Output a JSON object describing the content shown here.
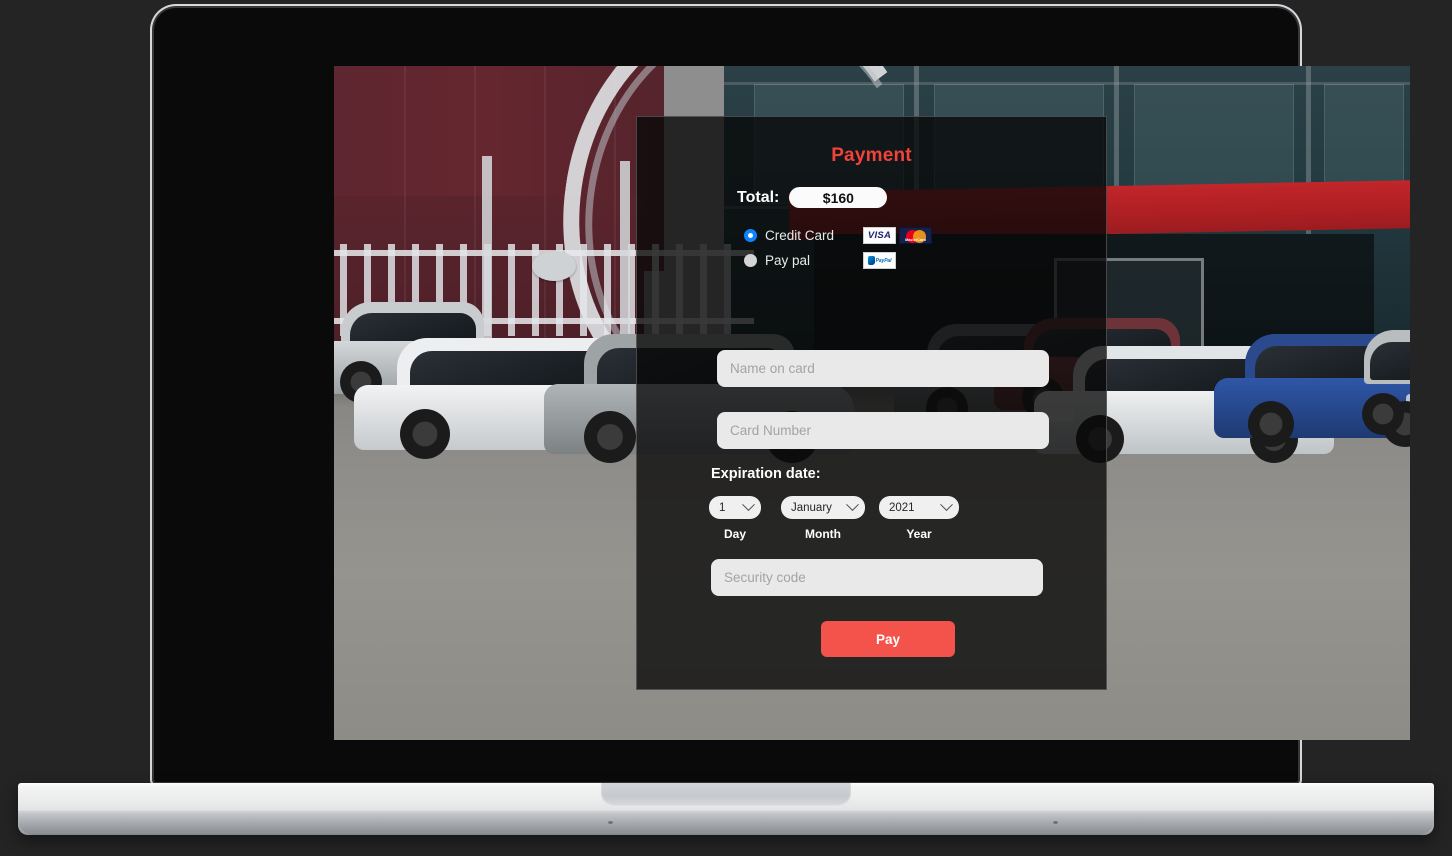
{
  "device": {
    "type": "laptop",
    "name": "macbook-mockup"
  },
  "background": {
    "scene": "car dealership lot with cars parked in front of a building"
  },
  "payment": {
    "title": "Payment",
    "total_label": "Total:",
    "total_value": "$160",
    "methods": [
      {
        "id": "credit-card",
        "label": "Credit Card",
        "selected": true,
        "brands": [
          {
            "id": "visa-logo",
            "text": "VISA"
          },
          {
            "id": "mastercard-logo",
            "text": "MasterCard"
          }
        ]
      },
      {
        "id": "pay-pal",
        "label": "Pay pal",
        "selected": false,
        "brands": [
          {
            "id": "paypal-logo",
            "text": "PayPal"
          }
        ]
      }
    ],
    "fields": {
      "name_on_card": {
        "value": "",
        "placeholder": "Name on card"
      },
      "card_number": {
        "value": "",
        "placeholder": "Card Number"
      },
      "security_code": {
        "value": "",
        "placeholder": "Security code"
      }
    },
    "expiration": {
      "heading": "Expiration date:",
      "day": {
        "value": "1",
        "caption": "Day"
      },
      "month": {
        "value": "January",
        "caption": "Month"
      },
      "year": {
        "value": "2021",
        "caption": "Year"
      }
    },
    "submit_label": "Pay",
    "colors": {
      "title_red": "#f2433a",
      "button_red": "#f4534c",
      "radio_blue": "#0a84ff",
      "field_grey": "#e9e9e9",
      "placeholder_grey": "#a3a3a3"
    }
  }
}
